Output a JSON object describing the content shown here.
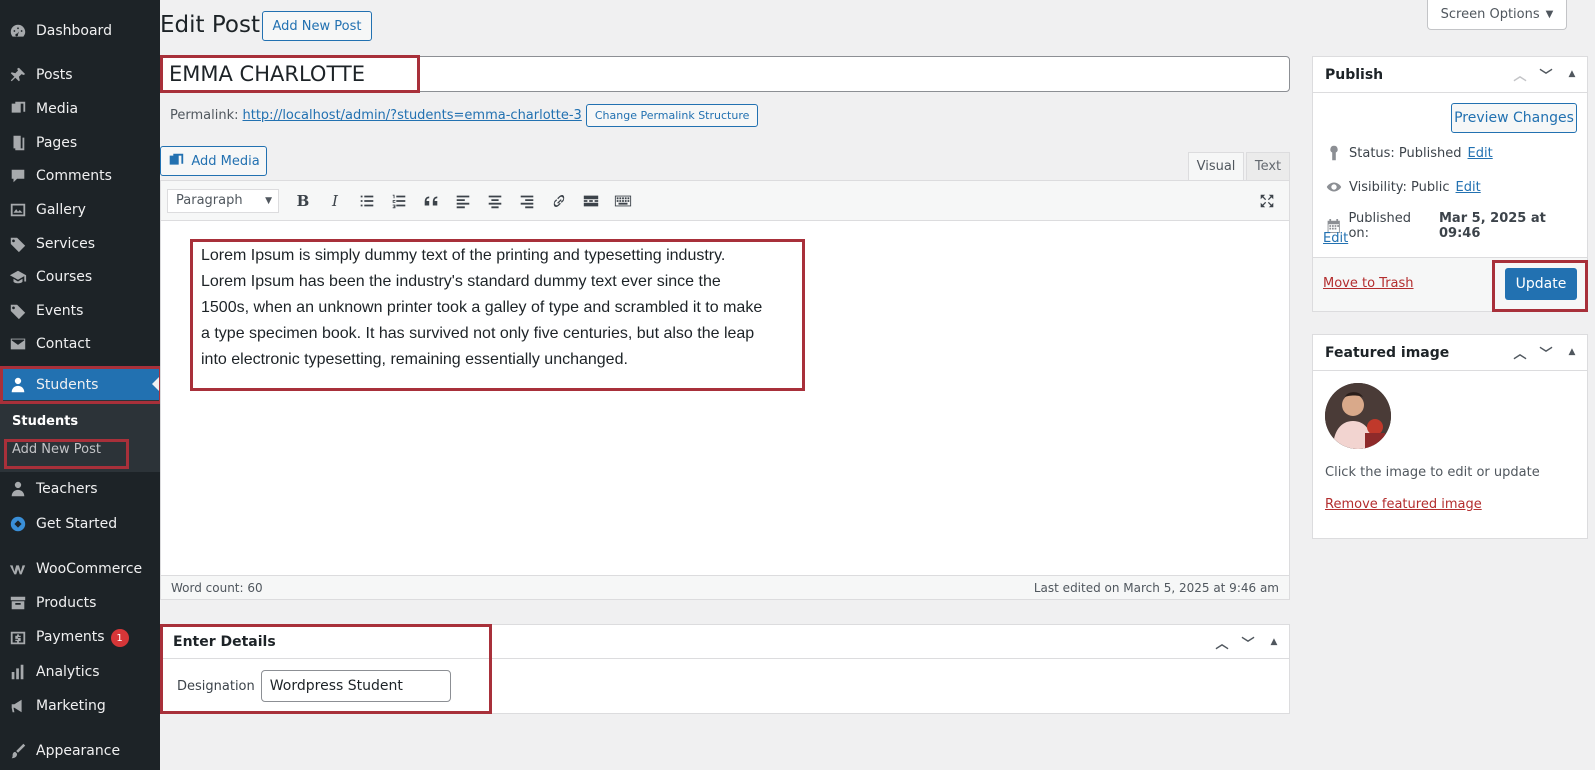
{
  "sidebar": {
    "items": [
      {
        "label": "Dashboard",
        "icon": "dashboard-icon"
      },
      {
        "label": "Posts",
        "icon": "pin-icon"
      },
      {
        "label": "Media",
        "icon": "media-icon"
      },
      {
        "label": "Pages",
        "icon": "pages-icon"
      },
      {
        "label": "Comments",
        "icon": "comment-icon"
      },
      {
        "label": "Gallery",
        "icon": "gallery-icon"
      },
      {
        "label": "Services",
        "icon": "tag-icon"
      },
      {
        "label": "Courses",
        "icon": "graduation-cap-icon"
      },
      {
        "label": "Events",
        "icon": "tag-icon"
      },
      {
        "label": "Contact",
        "icon": "email-icon"
      },
      {
        "label": "Students",
        "icon": "user-icon"
      },
      {
        "label": "Teachers",
        "icon": "user-icon"
      },
      {
        "label": "Get Started",
        "icon": "dashboard-icon"
      },
      {
        "label": "WooCommerce",
        "icon": "woo-icon"
      },
      {
        "label": "Products",
        "icon": "archive-icon"
      },
      {
        "label": "Payments",
        "icon": "money-icon",
        "badge": "1"
      },
      {
        "label": "Analytics",
        "icon": "chart-bar-icon"
      },
      {
        "label": "Marketing",
        "icon": "megaphone-icon"
      },
      {
        "label": "Appearance",
        "icon": "brush-icon"
      }
    ],
    "submenu": {
      "current": "Students",
      "add_new": "Add New Post"
    }
  },
  "header": {
    "title": "Edit Post",
    "add_new_label": "Add New Post",
    "screen_options": "Screen Options"
  },
  "post": {
    "title": "EMMA CHARLOTTE",
    "permalink_label": "Permalink:",
    "permalink_url": "http://localhost/admin/?students=emma-charlotte-3",
    "change_permalink": "Change Permalink Structure",
    "add_media": "Add Media",
    "tab_visual": "Visual",
    "tab_text": "Text",
    "format": "Paragraph",
    "body": "Lorem Ipsum is simply dummy text of the printing and typesetting industry. Lorem Ipsum has been the industry's standard dummy text ever since the 1500s, when an unknown printer took a galley of type and scrambled it to make a type specimen book. It has survived not only five centuries, but also the leap into electronic typesetting, remaining essentially unchanged.",
    "word_count": "Word count: 60",
    "last_edited": "Last edited on March 5, 2025 at 9:46 am"
  },
  "details": {
    "title": "Enter Details",
    "designation_label": "Designation",
    "designation_value": "Wordpress Student"
  },
  "publish": {
    "title": "Publish",
    "preview": "Preview Changes",
    "status": "Status: Published",
    "visibility": "Visibility: Public",
    "published_on_label": "Published on:",
    "published_on_value": "Mar 5, 2025 at 09:46",
    "edit": "Edit",
    "trash": "Move to Trash",
    "update": "Update"
  },
  "featured": {
    "title": "Featured image",
    "hint": "Click the image to edit or update",
    "remove": "Remove featured image"
  },
  "colors": {
    "sidebar_bg": "#1d2327",
    "accent": "#2271b1",
    "highlight_box": "#a8303a"
  }
}
